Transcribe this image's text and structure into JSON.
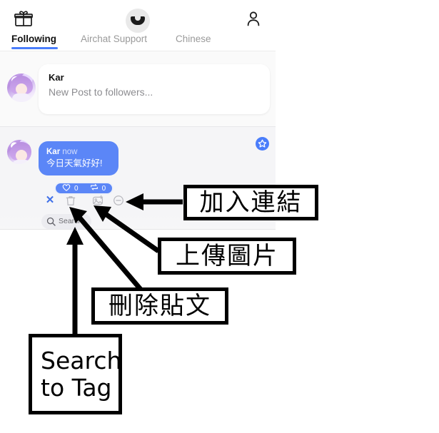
{
  "app": {
    "header": {
      "icons": [
        {
          "name": "gift-icon",
          "label": "gift"
        },
        {
          "name": "app-logo-avatar",
          "label": "Airchat"
        },
        {
          "name": "profile-icon",
          "label": "profile"
        }
      ],
      "tabs": [
        {
          "label": "Following",
          "active": true
        },
        {
          "label": "Airchat Support",
          "active": false
        },
        {
          "label": "Chinese",
          "active": false
        }
      ]
    },
    "composer": {
      "author": "Kar",
      "placeholder": "New Post to followers..."
    },
    "post": {
      "author": "Kar",
      "time": "now",
      "text": "今日天氣好好!",
      "like_count": "0",
      "repost_count": "0",
      "actions": [
        {
          "name": "cancel-post-button",
          "glyph": "✕",
          "label": "Cancel"
        },
        {
          "name": "delete-post-button",
          "glyph": "trash",
          "label": "Delete post"
        },
        {
          "name": "upload-image-button",
          "glyph": "image-plus",
          "label": "Upload image"
        },
        {
          "name": "add-link-button",
          "glyph": "link-circle",
          "label": "Add link"
        }
      ]
    },
    "search": {
      "placeholder": "Search",
      "value": "Search"
    },
    "star_button_label": "Favorite"
  },
  "annotations": [
    {
      "id": "add-link",
      "text": "加入連結"
    },
    {
      "id": "upload-image",
      "text": "上傳圖片"
    },
    {
      "id": "delete-post",
      "text": "刪除貼文"
    },
    {
      "id": "search-to-tag",
      "text": "Search\nto Tag"
    }
  ],
  "colors": {
    "accent_blue": "#4a7dfb",
    "bubble_blue": "#5b86f7",
    "feed_bg": "#f5f5f7",
    "annotation_black": "#000000"
  }
}
